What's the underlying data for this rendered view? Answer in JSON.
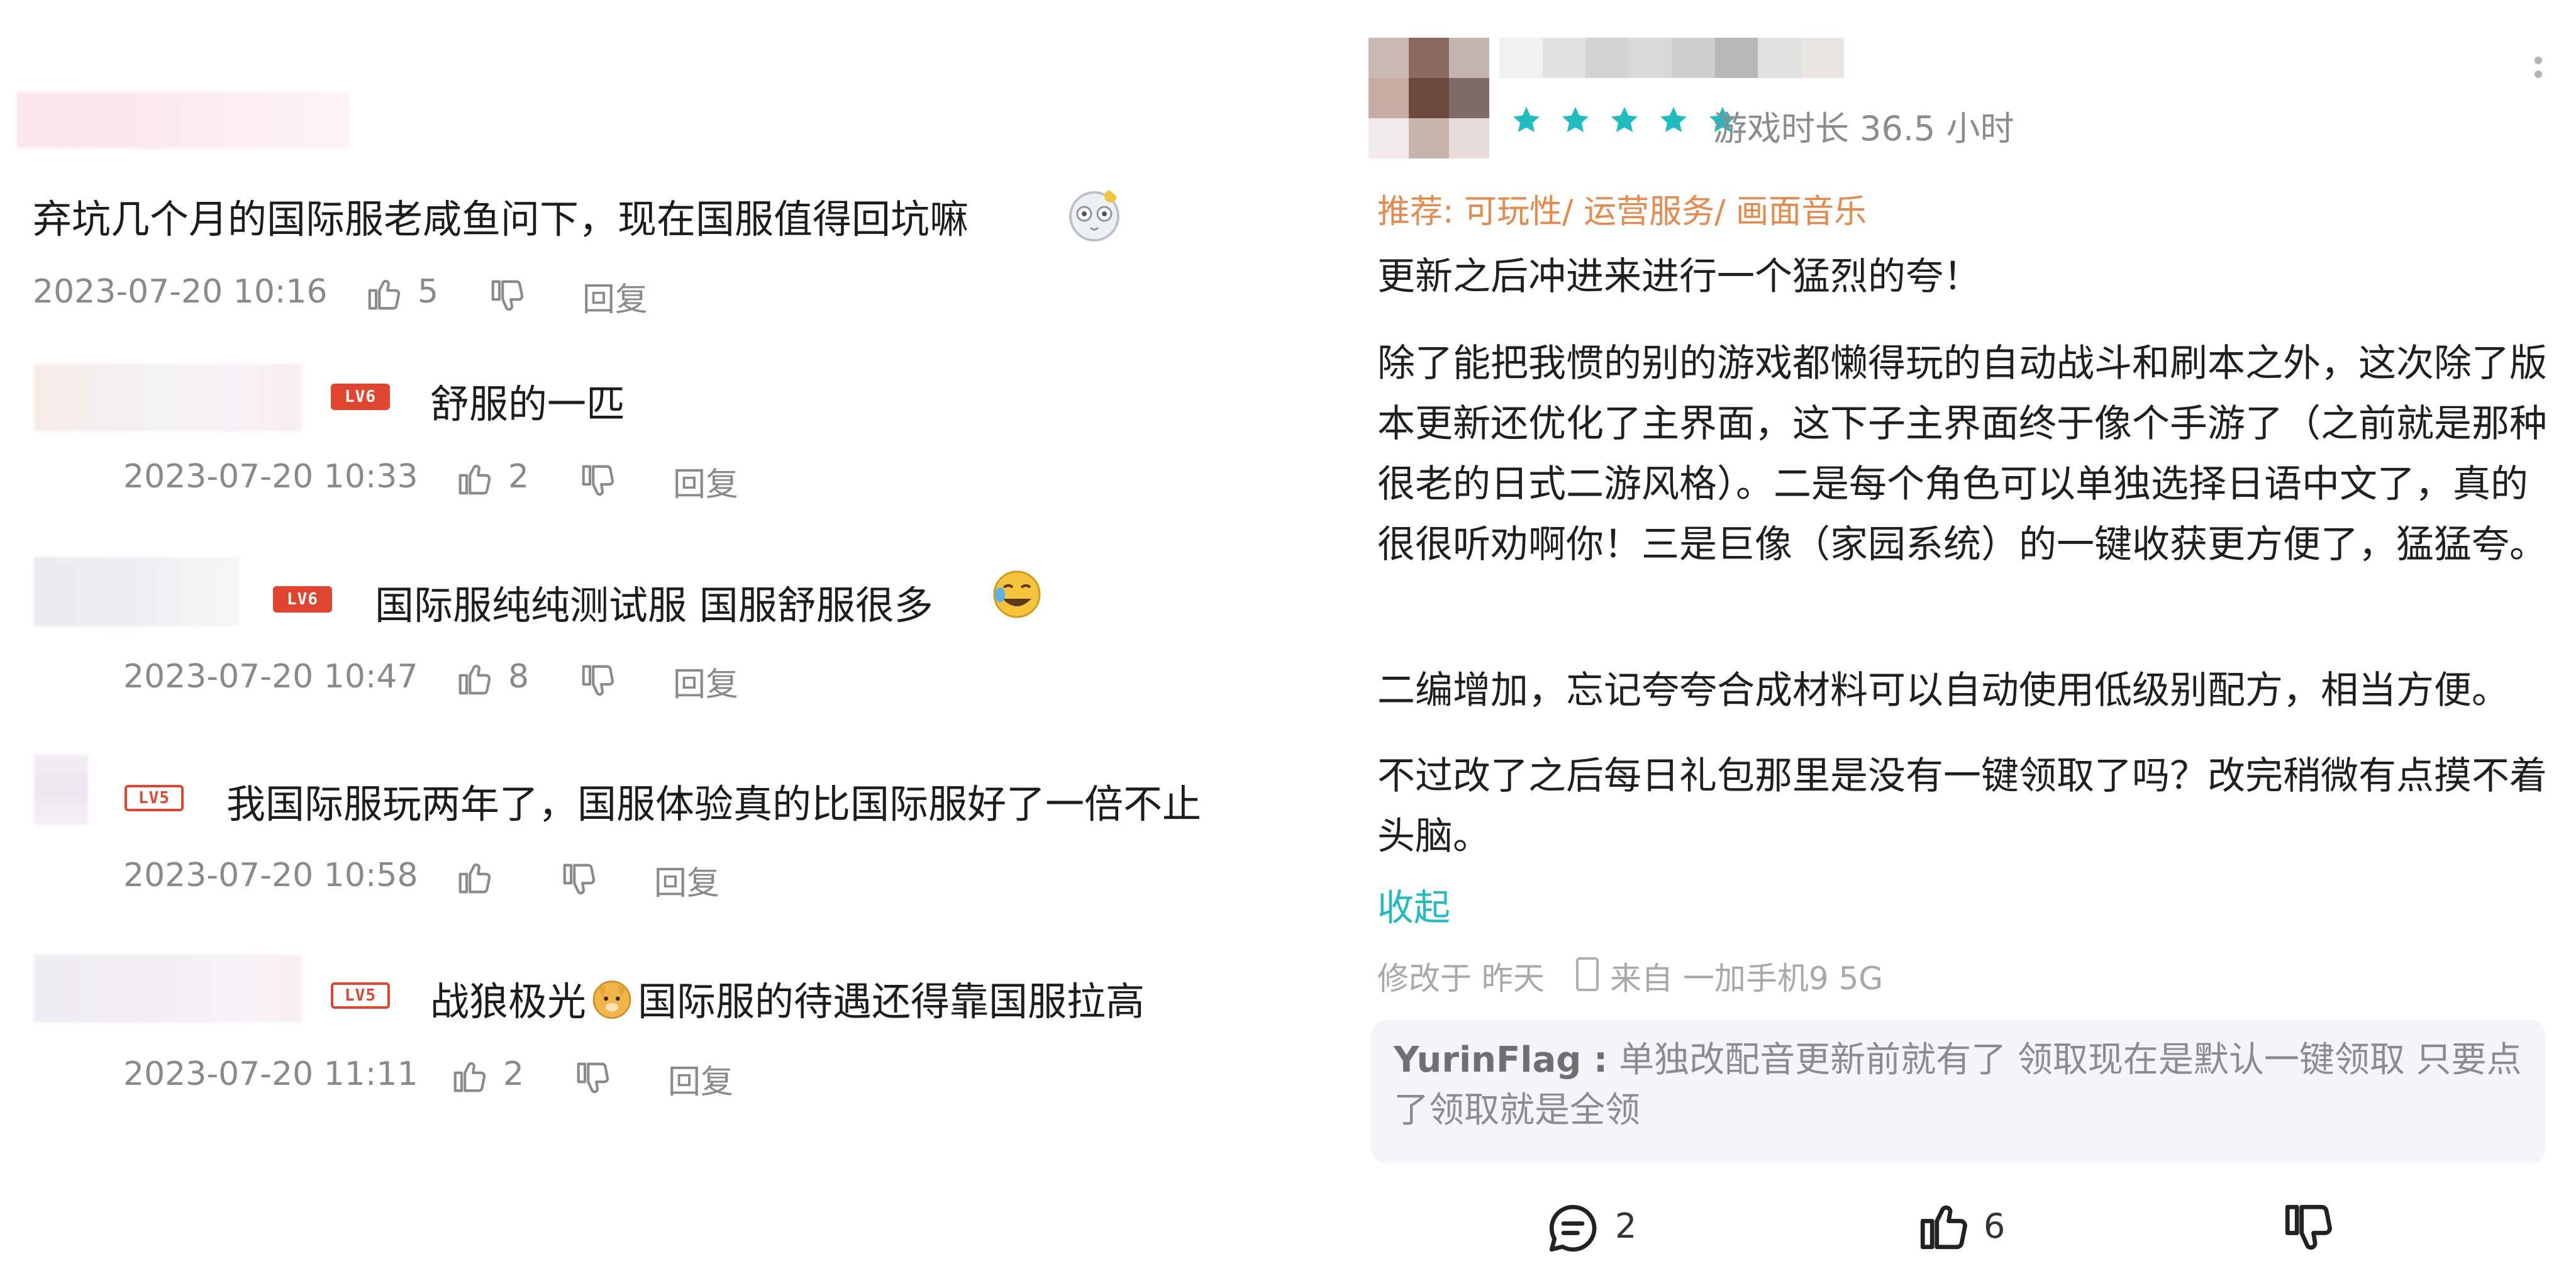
{
  "left": {
    "main_comment": {
      "text": "弃坑几个月的国际服老咸鱼问下，现在国服值得回坑嘛",
      "date": "2023-07-20 10:16",
      "likes": "5",
      "reply_label": "回复"
    },
    "replies": [
      {
        "level": "LV6",
        "text": "舒服的一匹",
        "date": "2023-07-20 10:33",
        "likes": "2",
        "reply_label": "回复"
      },
      {
        "level": "LV6",
        "text": "国际服纯纯测试服 国服舒服很多",
        "date": "2023-07-20 10:47",
        "likes": "8",
        "reply_label": "回复"
      },
      {
        "level": "LV5",
        "text": "我国际服玩两年了，国服体验真的比国际服好了一倍不止",
        "date": "2023-07-20 10:58",
        "likes": "",
        "reply_label": "回复"
      },
      {
        "level": "LV5",
        "text_a": "战狼极光",
        "text_b": "国际服的待遇还得靠国服拉高",
        "date": "2023-07-20 11:11",
        "likes": "2",
        "reply_label": "回复"
      }
    ]
  },
  "right": {
    "rating_stars": 5,
    "playtime": "游戏时长 36.5 小时",
    "recommend": "推荐: 可玩性/ 运营服务/ 画面音乐",
    "paragraphs": [
      "更新之后冲进来进行一个猛烈的夸！",
      "除了能把我惯的别的游戏都懒得玩的自动战斗和刷本之外，这次除了版本更新还优化了主界面，这下子主界面终于像个手游了（之前就是那种很老的日式二游风格）。二是每个角色可以单独选择日语中文了，真的很很听劝啊你！三是巨像（家园系统）的一键收获更方便了，猛猛夸。",
      "二编增加，忘记夸夸合成材料可以自动使用低级别配方，相当方便。",
      "不过改了之后每日礼包那里是没有一键领取了吗？改完稍微有点摸不着头脑。"
    ],
    "collapse_label": "收起",
    "modified": "修改于 昨天",
    "device": "来自 一加手机9 5G",
    "dev_reply": {
      "name": "YurinFlag :",
      "text": "单独改配音更新前就有了 领取现在是默认一键领取 只要点了领取就是全领"
    },
    "actions": {
      "comments": "2",
      "likes": "6"
    },
    "colors": {
      "star": "#1fbcc0",
      "recommend": "#e8894a",
      "link": "#1fbcc0"
    }
  }
}
